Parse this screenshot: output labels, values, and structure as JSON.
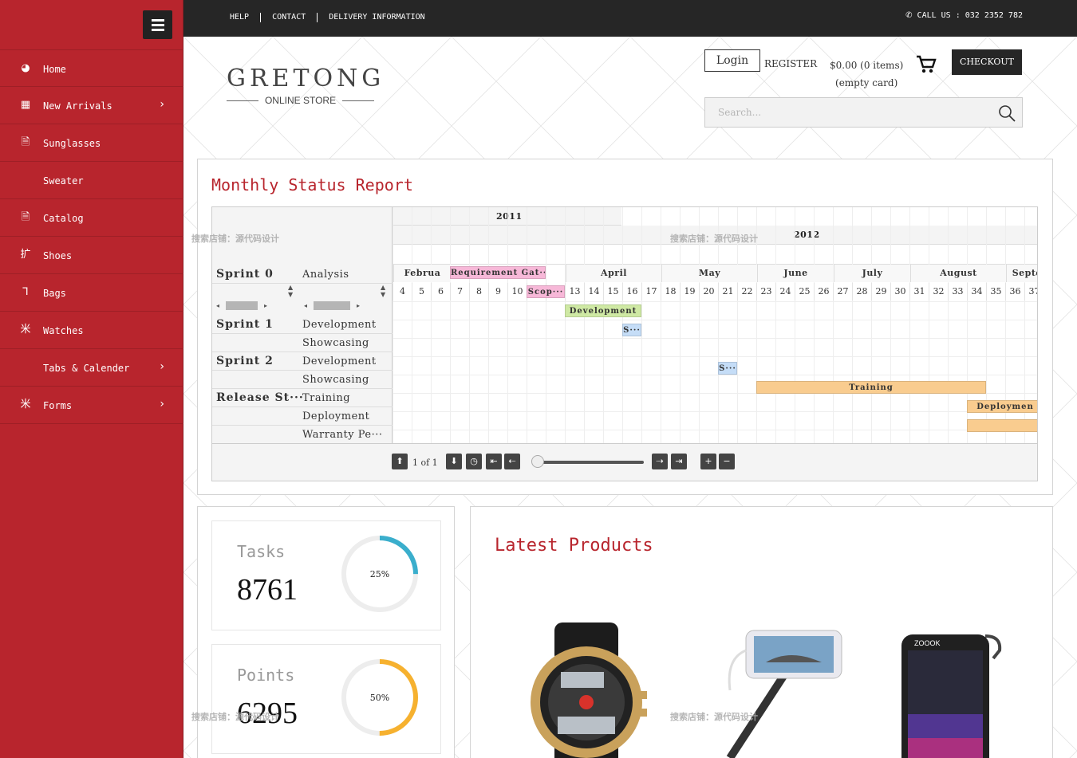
{
  "sidebar": {
    "menu_icon": "hamburger-icon",
    "items": [
      {
        "label": "Home",
        "icon": "dashboard-icon",
        "glyph": "◕",
        "has_children": false
      },
      {
        "label": "New Arrivals",
        "icon": "grid-icon",
        "glyph": "▦",
        "has_children": true
      },
      {
        "label": "Sunglasses",
        "icon": "document-icon",
        "glyph": "🗎",
        "has_children": false
      },
      {
        "label": "Sweater",
        "icon": "",
        "glyph": "",
        "has_children": false
      },
      {
        "label": "Catalog",
        "icon": "document-icon",
        "glyph": "🗎",
        "has_children": false
      },
      {
        "label": "Shoes",
        "icon": "extend-icon",
        "glyph": "扩",
        "has_children": false
      },
      {
        "label": "Bags",
        "icon": "bag-icon",
        "glyph": "⅂",
        "has_children": false
      },
      {
        "label": "Watches",
        "icon": "watch-icon",
        "glyph": "米",
        "has_children": false
      },
      {
        "label": "Tabs & Calender",
        "icon": "",
        "glyph": "",
        "has_children": true
      },
      {
        "label": "Forms",
        "icon": "form-icon",
        "glyph": "米",
        "has_children": true
      }
    ],
    "chevron": "›"
  },
  "topbar": {
    "links": [
      "HELP",
      "CONTACT",
      "DELIVERY INFORMATION"
    ],
    "phone_icon": "phone-icon",
    "call": "CALL US : 032 2352 782"
  },
  "header": {
    "logo_title": "GRETONG",
    "logo_subtitle": "ONLINE STORE",
    "login": "Login",
    "register": "REGISTER",
    "cart_total": "$0.00 (0 items)",
    "cart_note": "(empty card)",
    "checkout": "CHECKOUT",
    "search_placeholder": "Search..."
  },
  "report": {
    "title": "Monthly Status Report",
    "years": [
      "2011",
      "2012"
    ],
    "months": [
      "Februa",
      "April",
      "May",
      "June",
      "July",
      "August",
      "Septemb"
    ],
    "weeks": [
      "4",
      "5",
      "6",
      "7",
      "8",
      "9",
      "10",
      "11",
      "12",
      "13",
      "14",
      "15",
      "16",
      "17",
      "18",
      "19",
      "20",
      "21",
      "22",
      "23",
      "24",
      "25",
      "26",
      "27",
      "28",
      "29",
      "30",
      "31",
      "32",
      "33",
      "34",
      "35",
      "36",
      "37"
    ],
    "rows": [
      {
        "group": "Sprint 0",
        "task": "Analysis"
      },
      {
        "group": "Sprint 1",
        "task": "Development"
      },
      {
        "group": "",
        "task": "Showcasing"
      },
      {
        "group": "Sprint 2",
        "task": "Development"
      },
      {
        "group": "",
        "task": "Showcasing"
      },
      {
        "group": "Release St···",
        "task": "Training"
      },
      {
        "group": "",
        "task": "Deployment"
      },
      {
        "group": "",
        "task": "Warranty Pe···"
      }
    ],
    "bars": [
      {
        "label": "Requirement Gat···",
        "color": "#f7b8d8"
      },
      {
        "label": "Scop···",
        "color": "#f7b8d8"
      },
      {
        "label": "Development",
        "color": "#cfe9a4"
      },
      {
        "label": "S···",
        "color": "#c5ddf7"
      },
      {
        "label": "S···",
        "color": "#c5ddf7"
      },
      {
        "label": "Training",
        "color": "#f9cc8f"
      },
      {
        "label": "Deploymen",
        "color": "#f9cc8f"
      },
      {
        "label": "",
        "color": "#f9cc8f"
      }
    ],
    "pager": "1 of 1"
  },
  "stats": [
    {
      "label": "Tasks",
      "value": "8761",
      "percent_label": "25%",
      "fraction": 0.25,
      "color": "#3aaecc"
    },
    {
      "label": "Points",
      "value": "6295",
      "percent_label": "50%",
      "fraction": 0.5,
      "color": "#f6b12f"
    }
  ],
  "products": {
    "title": "Latest Products",
    "items": [
      {
        "name": "watch-image"
      },
      {
        "name": "selfie-stick-image"
      },
      {
        "name": "speaker-image"
      }
    ],
    "speaker_brand": "ZOOOK"
  },
  "watermarks": [
    "搜索店铺：源代码设计",
    "搜索店铺：源代码设计",
    "搜索店铺：源代码设计",
    "搜索店铺：源代码设计"
  ],
  "colors": {
    "brand": "#b8252d",
    "dark": "#262626"
  }
}
